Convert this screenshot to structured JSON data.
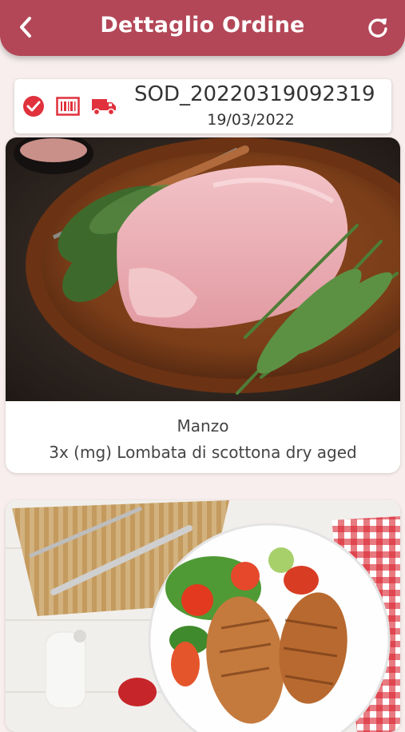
{
  "header": {
    "title": "Dettaglio Ordine",
    "back_icon": "chevron-left-icon",
    "refresh_icon": "refresh-icon",
    "color": "#b34757"
  },
  "order": {
    "code": "SOD_20220319092319",
    "date": "19/03/2022",
    "status_icons": [
      "check-circle-icon",
      "barcode-icon",
      "truck-icon"
    ],
    "accent": "#e0313c"
  },
  "products": [
    {
      "category": "Manzo",
      "description": "3x (mg) Lombata di scottona dry aged",
      "image": "pork-tenderloin-with-herbs-photo"
    },
    {
      "category": "",
      "description": "",
      "image": "grilled-chicken-salad-photo"
    }
  ]
}
